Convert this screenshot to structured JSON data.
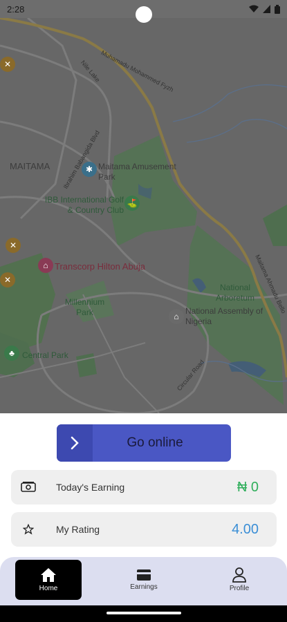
{
  "status_bar": {
    "time": "2:28"
  },
  "map": {
    "labels": {
      "road_north": "Muhamadu Mohammed Fyzh",
      "nile_lake": "Nile Lake",
      "bangala": "Ibrahim Babangida Blvd",
      "maitama": "MAITAMA",
      "amusement_park": "Maitama Amusement Park",
      "ibb_golf": "IBB International Golf & Country Club",
      "transcorp": "Transcorp Hilton Abuja",
      "millennium_park": "Millennium Park",
      "national_arboretum": "National Arboretum",
      "national_assembly": "National Assembly of Nigeria",
      "central_park": "Central Park",
      "circular_road": "Circular Road",
      "ahmadu_bello": "Maitama Ahmadu Bello"
    }
  },
  "go_online": {
    "label": "Go online"
  },
  "earning": {
    "label": "Today's Earning",
    "value": "₦ 0"
  },
  "rating": {
    "label": "My Rating",
    "value": "4.00"
  },
  "nav": {
    "home": "Home",
    "earnings": "Earnings",
    "profile": "Profile"
  },
  "colors": {
    "primary": "#4a57c4",
    "earning_green": "#2fae5b",
    "rating_blue": "#3a8ed6",
    "nav_bg": "#dcdef0"
  }
}
